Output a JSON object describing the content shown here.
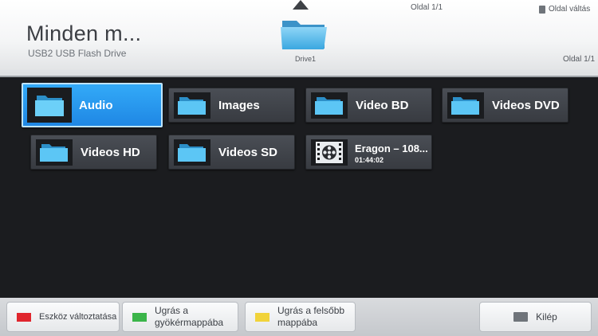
{
  "header": {
    "title": "Minden m...",
    "subtitle": "USB2 USB Flash Drive",
    "drive_label": "Drive1",
    "page_top": "Oldal 1/1",
    "page_switch": "Oldal váltás",
    "page_right": "Oldal 1/1"
  },
  "grid": {
    "items": [
      {
        "label": "Audio",
        "type": "folder",
        "selected": true
      },
      {
        "label": "Images",
        "type": "folder"
      },
      {
        "label": "Video BD",
        "type": "folder"
      },
      {
        "label": "Videos DVD",
        "type": "folder"
      },
      {
        "label": "Videos HD",
        "type": "folder"
      },
      {
        "label": "Videos SD",
        "type": "folder"
      },
      {
        "label": "Eragon – 108...",
        "sub": "01:44:02",
        "type": "video"
      }
    ]
  },
  "footer": {
    "buttons": [
      {
        "label": "Eszköz változtatása",
        "color": "#e0262d"
      },
      {
        "label_line1": "Ugrás a",
        "label_line2": "gyökérmappába",
        "color": "#3bb54a"
      },
      {
        "label_line1": "Ugrás a felsőbb",
        "label_line2": "mappába",
        "color": "#f1d33a"
      },
      {
        "label": "Kilép",
        "icon": "exit-key-icon"
      }
    ]
  },
  "colors": {
    "accent": "#2196f0",
    "background": "#1b1c1f",
    "folder": "#52c0f2"
  }
}
